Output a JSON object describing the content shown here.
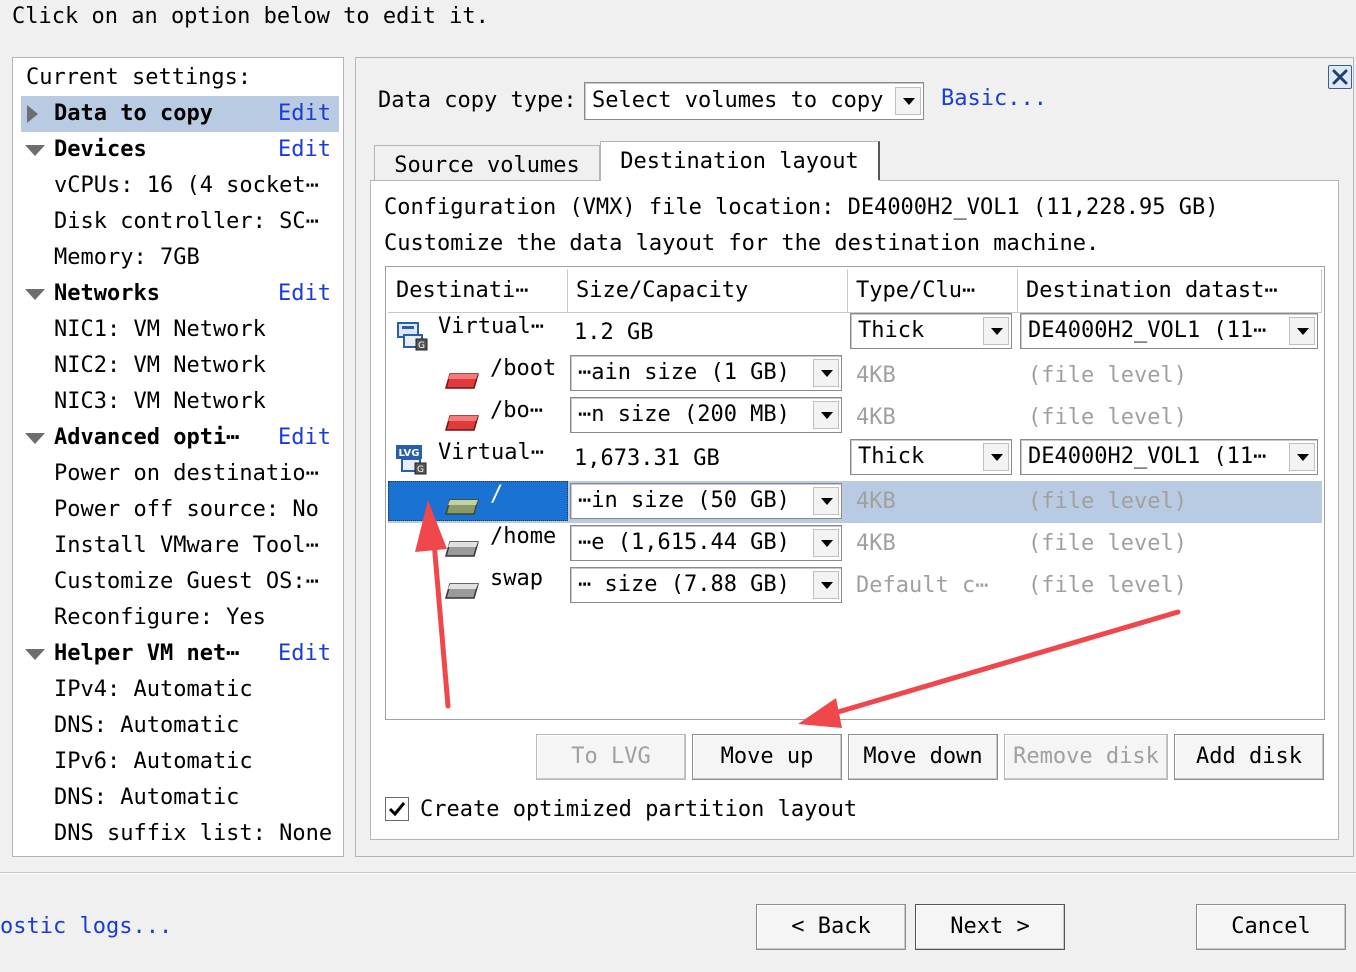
{
  "instruction": "Click on an option below to edit it.",
  "settings": {
    "title": "Current settings:",
    "sections": [
      {
        "heading": "Data to copy",
        "edit_label": "Edit",
        "items": []
      },
      {
        "heading": "Devices",
        "edit_label": "Edit",
        "items": [
          "vCPUs: 16 (4 socket⋯",
          "Disk controller: SC⋯",
          "Memory: 7GB"
        ]
      },
      {
        "heading": "Networks",
        "edit_label": "Edit",
        "items": [
          "NIC1: VM Network",
          "NIC2: VM Network",
          "NIC3: VM Network"
        ]
      },
      {
        "heading": "Advanced opti⋯",
        "edit_label": "Edit",
        "items": [
          "Power on destinatio⋯",
          "Power off source: No",
          "Install VMware Tool⋯",
          "Customize Guest OS:⋯",
          "Reconfigure: Yes"
        ]
      },
      {
        "heading": "Helper VM net⋯",
        "edit_label": "Edit",
        "items": [
          "IPv4: Automatic",
          "DNS: Automatic",
          "IPv6: Automatic",
          "DNS: Automatic",
          "DNS suffix list: None"
        ]
      }
    ]
  },
  "copy_type": {
    "label": "Data copy type:",
    "value": "Select volumes to copy",
    "link": "Basic..."
  },
  "tabs": [
    "Source volumes",
    "Destination layout"
  ],
  "destination": {
    "config_location": "Configuration (VMX) file location: DE4000H2_VOL1 (11,228.95 GB)",
    "customize_text": "Customize the data layout for the destination machine.",
    "columns": [
      "Destinati⋯",
      "Size/Capacity",
      "Type/Clu⋯",
      "Destination datast⋯"
    ],
    "rows": [
      {
        "name": "Virtual⋯",
        "size": "1.2 GB",
        "type": "Thick",
        "datastore": "DE4000H2_VOL1 (11⋯"
      },
      {
        "name": "/boot",
        "size": "⋯ain size (1 GB)",
        "type": "4KB",
        "datastore": "(file level)"
      },
      {
        "name": "/bo⋯",
        "size": "⋯n size (200 MB)",
        "type": "4KB",
        "datastore": "(file level)"
      },
      {
        "name": "Virtual⋯",
        "size": "1,673.31 GB",
        "type": "Thick",
        "datastore": "DE4000H2_VOL1 (11⋯"
      },
      {
        "name": "/",
        "size": "⋯in size (50 GB)",
        "type": "4KB",
        "datastore": "(file level)"
      },
      {
        "name": "/home",
        "size": "⋯e (1,615.44 GB)",
        "type": "4KB",
        "datastore": "(file level)"
      },
      {
        "name": "swap",
        "size": "⋯ size (7.88 GB)",
        "type": "Default c⋯",
        "datastore": "(file level)"
      }
    ],
    "buttons": {
      "to_lvg": "To LVG",
      "move_up": "Move up",
      "move_down": "Move down",
      "remove_disk": "Remove disk",
      "add_disk": "Add disk"
    },
    "checkbox_label": "Create optimized partition layout",
    "checkbox_checked": true,
    "lvg_icon_text": "LVG"
  },
  "footer": {
    "diag_link": "ostic logs...",
    "back": "< Back",
    "next": "Next >",
    "cancel": "Cancel"
  },
  "colors": {
    "link": "#1a3cd6",
    "selection": "#b9cbe3",
    "selected_name": "#1a72d2",
    "annotation_arrow": "#f0474d"
  }
}
